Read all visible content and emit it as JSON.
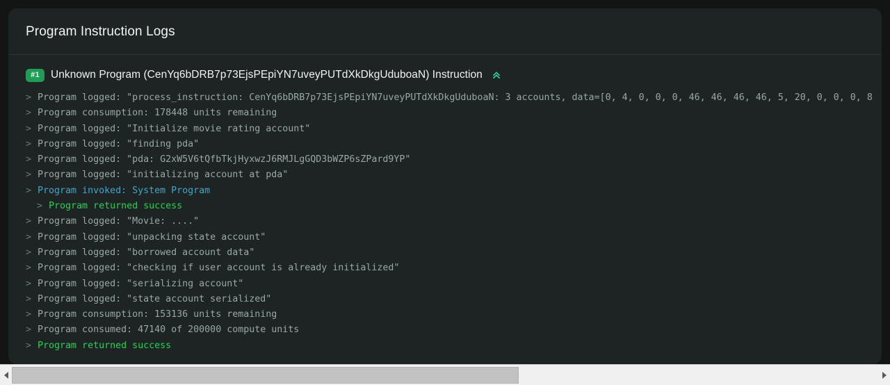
{
  "header": {
    "title": "Program Instruction Logs"
  },
  "instruction": {
    "badge": "#1",
    "title": "Unknown Program (CenYq6bDRB7p73EjsPEpiYN7uveyPUTdXkDkgUduboaN) Instruction",
    "collapse_icon": "chevrons-up-icon",
    "accent_color": "#1f9c55",
    "logs": [
      {
        "marker": ">",
        "depth": 0,
        "type": "default",
        "text": "Program logged: \"process_instruction: CenYq6bDRB7p73EjsPEpiYN7uveyPUTdXkDkgUduboaN: 3 accounts, data=[0, 4, 0, 0, 0, 46, 46, 46, 46, 5, 20, 0, 0, 0, 8"
      },
      {
        "marker": ">",
        "depth": 0,
        "type": "default",
        "text": "Program consumption: 178448 units remaining"
      },
      {
        "marker": ">",
        "depth": 0,
        "type": "default",
        "text": "Program logged: \"Initialize movie rating account\""
      },
      {
        "marker": ">",
        "depth": 0,
        "type": "default",
        "text": "Program logged: \"finding pda\""
      },
      {
        "marker": ">",
        "depth": 0,
        "type": "default",
        "text": "Program logged: \"pda: G2xW5V6tQfbTkjHyxwzJ6RMJLgGQD3bWZP6sZPard9YP\""
      },
      {
        "marker": ">",
        "depth": 0,
        "type": "default",
        "text": "Program logged: \"initializing account at pda\""
      },
      {
        "marker": ">",
        "depth": 0,
        "type": "invoke",
        "text": "Program invoked: System Program"
      },
      {
        "marker": ">",
        "depth": 1,
        "type": "success",
        "text": "Program returned success"
      },
      {
        "marker": ">",
        "depth": 0,
        "type": "default",
        "text": "Program logged: \"Movie: ....\""
      },
      {
        "marker": ">",
        "depth": 0,
        "type": "default",
        "text": "Program logged: \"unpacking state account\""
      },
      {
        "marker": ">",
        "depth": 0,
        "type": "default",
        "text": "Program logged: \"borrowed account data\""
      },
      {
        "marker": ">",
        "depth": 0,
        "type": "default",
        "text": "Program logged: \"checking if user account is already initialized\""
      },
      {
        "marker": ">",
        "depth": 0,
        "type": "default",
        "text": "Program logged: \"serializing account\""
      },
      {
        "marker": ">",
        "depth": 0,
        "type": "default",
        "text": "Program logged: \"state account serialized\""
      },
      {
        "marker": ">",
        "depth": 0,
        "type": "default",
        "text": "Program consumption: 153136 units remaining"
      },
      {
        "marker": ">",
        "depth": 0,
        "type": "default",
        "text": "Program consumed: 47140 of 200000 compute units"
      },
      {
        "marker": ">",
        "depth": 0,
        "type": "success",
        "text": "Program returned success"
      }
    ]
  },
  "scrollbar": {
    "left_arrow_icon": "arrow-left-icon",
    "right_arrow_icon": "arrow-right-icon",
    "thumb_name": "horizontal-scroll-thumb"
  }
}
